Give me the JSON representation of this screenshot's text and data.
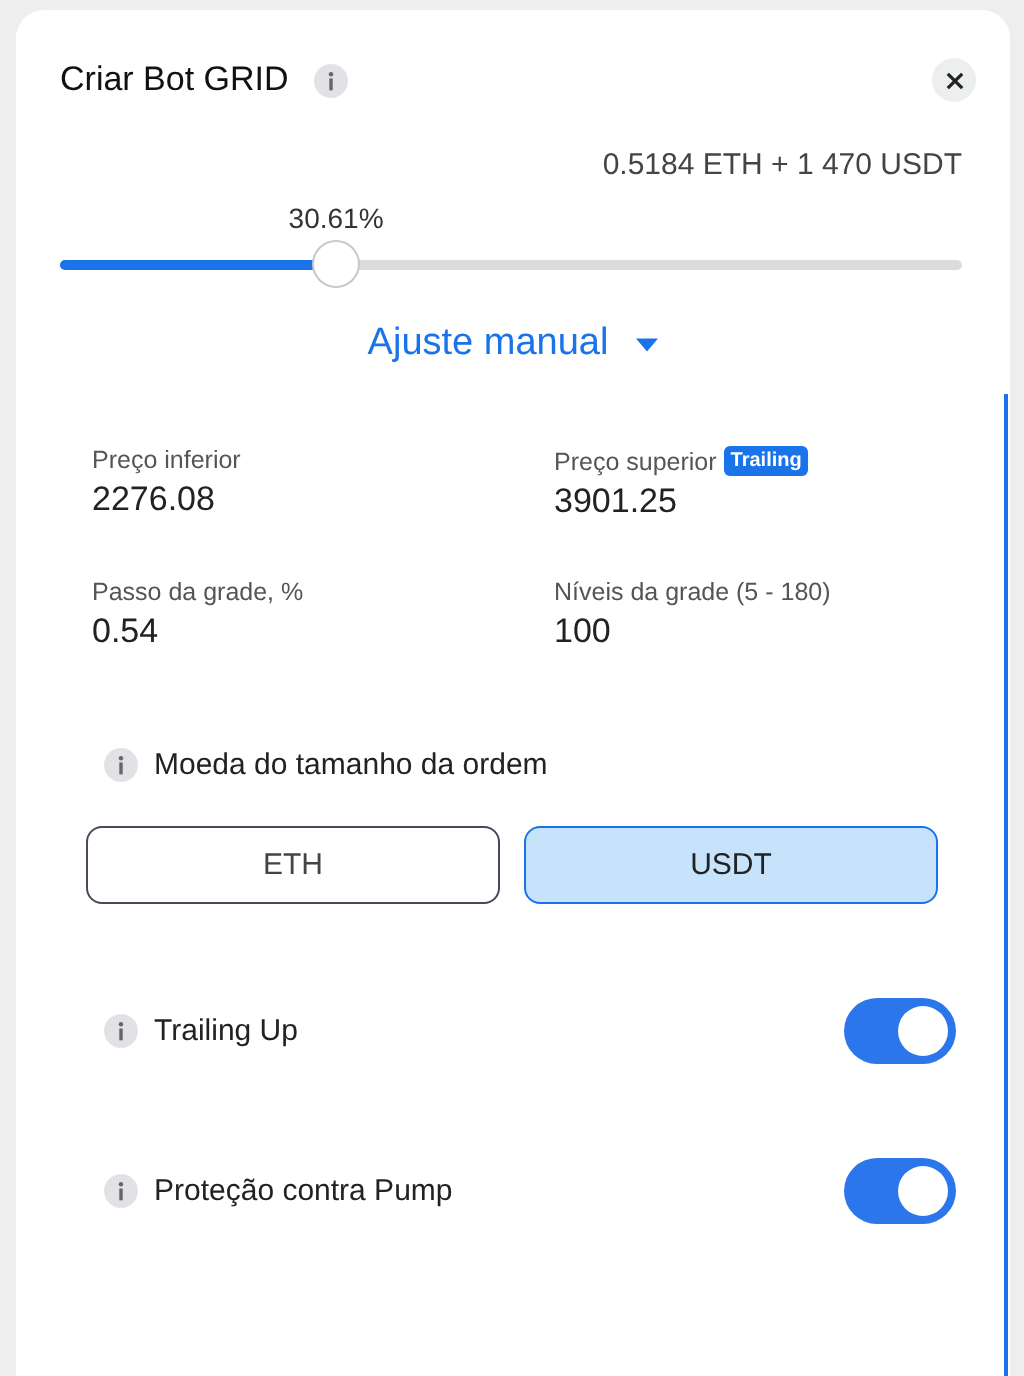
{
  "dialog": {
    "title": "Criar Bot GRID",
    "balance": "0.5184 ETH + 1 470 USDT"
  },
  "investment": {
    "reading": "30.61%",
    "level": 0.3061
  },
  "mode": {
    "label": "Ajuste manual"
  },
  "fields": [
    {
      "label": "Preço inferior",
      "value": "2276.08"
    },
    {
      "label": "Preço superior",
      "badge": "Trailing",
      "value": "3901.25"
    },
    {
      "label": "Passo da grade, %",
      "value": "0.54"
    },
    {
      "label": "Níveis da grade (5 - 180)",
      "value": "100"
    }
  ],
  "order_currency": {
    "label": "Moeda do tamanho da ordem",
    "options": [
      {
        "label": "ETH",
        "selected": false
      },
      {
        "label": "USDT",
        "selected": true
      }
    ]
  },
  "switches": [
    {
      "label": "Trailing Up",
      "on": true
    },
    {
      "label": "Proteção contra Pump",
      "on": true
    }
  ]
}
